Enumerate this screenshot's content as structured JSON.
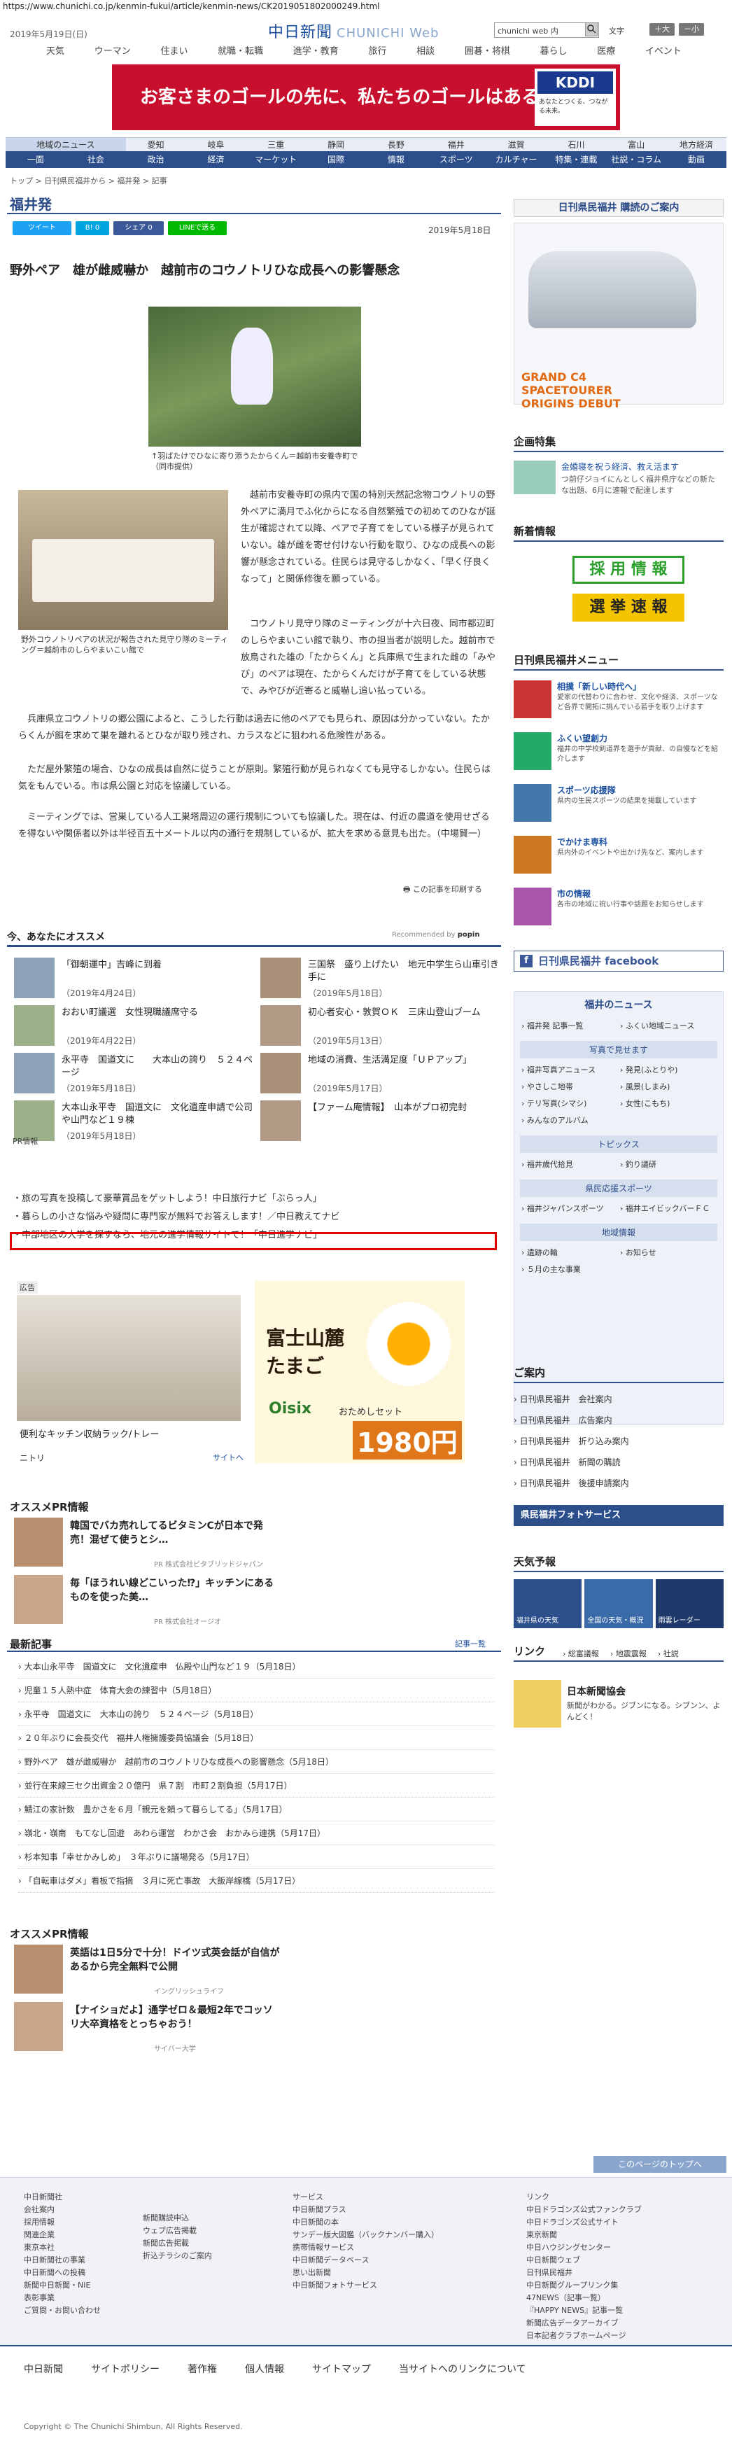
{
  "browser_url": "https://www.chunichi.co.jp/kenmin-fukui/article/kenmin-news/CK2019051802000249.html",
  "header": {
    "date": "2019年5月19日(日)",
    "logo": "中日新聞",
    "logo_sub": "CHUNICHI Web",
    "search_placeholder": "chunichi web 内",
    "font_label": "文字",
    "font_large": "＋大",
    "font_small": "－小",
    "global_nav": [
      "天気",
      "ウーマン",
      "住まい",
      "就職・転職",
      "進学・教育",
      "旅行",
      "相談",
      "囲碁・将棋",
      "暮らし",
      "医療",
      "イベント"
    ]
  },
  "banner": {
    "text": "お客さまのゴールの先に、私たちのゴールはある。",
    "brand": "KDDI",
    "sub": "あなたとつくる、つながる未来。"
  },
  "prefecture_nav": [
    "地域のニュース",
    "愛知",
    "岐阜",
    "三重",
    "静岡",
    "長野",
    "福井",
    "滋賀",
    "石川",
    "富山",
    "地方経済"
  ],
  "category_nav": [
    "一面",
    "社会",
    "政治",
    "経済",
    "マーケット",
    "国際",
    "情報",
    "スポーツ",
    "カルチャー",
    "特集・連載",
    "社説・コラム",
    "動画"
  ],
  "breadcrumb": "トップ > 日刊県民福井から > 福井発 > 記事",
  "section_title": "福井発",
  "share": {
    "tweet": "ツイート",
    "hatena": "B! 0",
    "facebook": "シェア 0",
    "line": "LINEで送る"
  },
  "article": {
    "date": "2019年5月18日",
    "title": "野外ペア　雄が雌威嚇か　越前市のコウノトリひな成長への影響懸念",
    "photo1_caption": "↑羽ばたけでひなに寄り添うたからくん＝越前市安養寺町で（同市提供）",
    "photo2_caption": "野外コウノトリペアの状況が報告された見守り隊のミーティング＝越前市のしらやまいこい館で",
    "p1": "越前市安養寺町の県内で国の特別天然記念物コウノトリの野外ペアに満月でふ化からになる自然繁殖での初めてのひなが誕生が確認されて以降、ペアで子育てをしている様子が見られていない。雄が雌を寄せ付けない行動を取り、ひなの成長への影響が懸念されている。住民らは見守るしかなく、「早く仔良くなって」と関係修復を願っている。",
    "p2": "コウノトリ見守り隊のミーティングが十六日夜、同市都辺町のしらやまいこい館で執り、市の担当者が説明した。越前市で放鳥された雄の「たからくん」と兵庫県で生まれた雌の「みやび」のペアは現在、たからくんだけが子育てをしている状態で、みやびが近寄ると威嚇し追い払っている。",
    "p3": "兵庫県立コウノトリの郷公園によると、こうした行動は過去に他のペアでも見られ、原因は分かっていない。たからくんが餌を求めて巣を離れるとひなが取り残され、カラスなどに狙われる危険性がある。",
    "p4": "ただ屋外繁殖の場合、ひなの成長は自然に従うことが原則。繁殖行動が見られなくても見守るしかない。住民らは気をもんでいる。市は県公園と対応を協議している。",
    "p5": "ミーティングでは、営巣している人工巣塔周辺の運行規制についても協議した。現在は、付近の農道を使用せざるを得ないや関係者以外は半径百五十メートル以内の通行を規制しているが、拡大を求める意見も出た。（中場賢一）",
    "print": "この記事を印刷する"
  },
  "recommend": {
    "title": "今、あなたにオススメ",
    "credit": "Recommended by",
    "items": [
      {
        "title": "「御朝運中」吉峰に到着",
        "date": "（2019年4月24日）"
      },
      {
        "title": "三国祭　盛り上げたい　地元中学生ら山車引き手に",
        "date": "（2019年5月18日）"
      },
      {
        "title": "おおい町議選　女性現職議席守る",
        "date": "（2019年4月22日）"
      },
      {
        "title": "初心者安心・敦賀ＯＫ　三床山登山ブーム",
        "date": "（2019年5月13日）"
      },
      {
        "title": "永平寺　国道文に　　大本山の誇り　５２４ページ",
        "date": "（2019年5月18日）"
      },
      {
        "title": "地域の消費、生活満足度「ＵＰアップ」",
        "date": "（2019年5月17日）"
      },
      {
        "title": "大本山永平寺　国道文に　文化遺産申請で公司や山門など１９棟",
        "date": "（2019年5月18日）"
      },
      {
        "title": "【ファーム庵情報】　山本がプロ初完封",
        "date": ""
      }
    ]
  },
  "pr": {
    "label": "PR情報",
    "items": [
      "旅の写真を投稿して豪華賞品をゲットしよう！中日旅行ナビ「ぶらっ人」",
      "暮らしの小さな悩みや疑問に専門家が無料でお答えします！／中日教えてナビ",
      "中部地区の大学を探すなら、地元の進学情報サイトで！「中日進学ナビ」"
    ]
  },
  "ad2": {
    "label": "広告",
    "left_caption": "便利なキッチン収納ラック/トレー",
    "left_brand": "ニトリ",
    "left_link": "サイトへ",
    "right_title": "富士山麓たまご",
    "right_brand": "Oisix",
    "right_sub": "おためしセット",
    "right_price": "1980円"
  },
  "osusume_pr": {
    "title": "オススメPR情報",
    "items": [
      {
        "title": "韓国でバカ売れしてるビタミンCが日本で発売！混ぜて使うとシ…",
        "sponsor": "PR 株式会社ビタブリッドジャパン"
      },
      {
        "title": "毎「ほうれい線どこいった⁉」キッチンにあるものを使った美…",
        "sponsor": "PR 株式会社オージオ"
      }
    ]
  },
  "latest": {
    "title": "最新記事",
    "link": "記事一覧",
    "items": [
      "大本山永平寺　国道文に　文化遺産申　仏殿や山門など１９（5月18日）",
      "児童１５人熱中症　体育大会の練習中（5月18日）",
      "永平寺　国道文に　大本山の誇り　５２４ページ（5月18日）",
      "２０年ぶりに会長交代　福井人権擁護委員協議会（5月18日）",
      "野外ペア　雄が雌威嚇か　越前市のコウノトリひな成長への影響懸念（5月18日）",
      "並行在来線三セク出資金２０億円　県７割　市町２割負担（5月17日）",
      "鯖江の家計数　豊かさを６月「親元を頼って暮らしてる」（5月17日）",
      "嶺北・嶺南　もてなし回遊　あわら運営　わかさ会　おかみら連携（5月17日）",
      "杉本知事「幸せかみしめ」　３年ぶりに議場発る（5月17日）",
      "「自転車はダメ」看板で指摘　３月に死亡事故　大飯岸線橋（5月17日）"
    ]
  },
  "osusume_pr2": {
    "title": "オススメPR情報",
    "items": [
      {
        "title": "英語は1日5分で十分！ドイツ式英会話が自信があるから完全無料で公開",
        "sponsor": "イングリッシュライフ"
      },
      {
        "title": "【ナイショだよ】通学ゼロ＆最短2年でコッソリ大卒資格をとっちゃおう！",
        "sponsor": "サイバー大学"
      }
    ]
  },
  "sidebar": {
    "kenmin_title": "日刊県民福井 購読のご案内",
    "car_ad": "GRAND C4 SPACETOURER ORIGINS DEBUT",
    "kikaku_title": "企画特集",
    "kikaku_item": "金婚寝を祝う経済、救え活ます",
    "kikaku_desc": "つ前仔ジョイにんとしく福井県庁などの新たな出題、6月に速報で配達します",
    "shinsotsu_title": "新着情報",
    "saiyo": "採 用 情 報",
    "senkyo": "選 挙 速 報",
    "menu_title": "日刊県民福井メニュー",
    "menu_items": [
      {
        "title": "相撲「新しい時代へ」",
        "desc": "愛家の代替わりに合わせ、文化や経済、スポーツなど各界で開拓に挑んでいる若手を取り上げます"
      },
      {
        "title": "ふくい望創力",
        "desc": "福井の中学校剣道界を選手が貢献、の自慢などを紹介します"
      },
      {
        "title": "スポーツ応援隊",
        "desc": "県内の生民スポーツの結果を掲載しています"
      },
      {
        "title": "でかけま専科",
        "desc": "県内外のイベントや出かけ先など、案内します"
      },
      {
        "title": "市の情報",
        "desc": "各市の地域に祝い行事や話題をお知らせします"
      }
    ],
    "facebook": "日刊県民福井 facebook",
    "fukui_news": "福井のニュース",
    "fukui_links": [
      "福井発 記事一覧",
      "ふくい地域ニュース"
    ],
    "photo_title": "写真で見せます",
    "photo_links": [
      "福井写真アニュース",
      "発見(ふとりや)",
      "やさしこ地帯",
      "風景(しまみ)",
      "テリ写真(シマシ)",
      "女性(こもち)",
      "みんなのアルバム"
    ],
    "topics_title": "トピックス",
    "topics_links": [
      "福井歳代拾見",
      "釣り議研"
    ],
    "sports_title": "県民応援スポーツ",
    "sports_links": [
      "福井ジャパンスポーツ",
      "福井エイビックバーＦＣ"
    ],
    "local_title": "地域情報",
    "local_links": [
      "遺跡の輪",
      "お知らせ",
      "５月の主な事業"
    ],
    "annai_title": "ご案内",
    "annai_links": [
      "日刊県民福井　会社案内",
      "日刊県民福井　広告案内",
      "日刊県民福井　折り込み案内",
      "日刊県民福井　新聞の購読",
      "日刊県民福井　後援申請案内"
    ],
    "photo_service": "県民福井フォトサービス",
    "weather_title": "天気予報",
    "weather_tiles": [
      "福井県の天気",
      "全国の天気・概況",
      "雨雲レーダー"
    ],
    "link_title": "リンク",
    "link_items": [
      "総富議報",
      "地震震報",
      "社説"
    ],
    "jinzai_title": "日本新聞協会",
    "jinzai_desc": "新聞がわかる。ジブンになる。シブンン、よんどく！"
  },
  "page_top": "このページのトップへ",
  "footer": {
    "col1": [
      "中日新聞社",
      "会社案内",
      "採用情報",
      "関連企業",
      "東京本社",
      "中日新聞社の事業",
      "中日新聞への投稿",
      "新聞中日新聞・NIE",
      "表彰事業",
      "ご質問・お問い合わせ"
    ],
    "col2": [
      "新聞購読申込",
      "ウェブ広告掲載",
      "新聞広告掲載",
      "折込チラシのご案内"
    ],
    "col3": [
      "サービス",
      "中日新聞プラス",
      "中日新聞の本",
      "サンデー版大図鑑（バックナンバー購入）",
      "携帯情報サービス",
      "中日新聞データベース",
      "思い出新聞",
      "中日新聞フォトサービス"
    ],
    "col4": [
      "リンク",
      "中日ドラゴンズ公式ファンクラブ",
      "中日ドラゴンズ公式サイト",
      "東京新聞",
      "中日ハウジングセンター",
      "中日新聞ウェブ",
      "日刊県民福井",
      "中日新聞グループリンク集",
      "47NEWS（記事一覧）",
      "『HAPPY NEWS』記事一覧",
      "新聞広告データアーカイブ",
      "日本記者クラブホームページ"
    ],
    "nav": [
      "中日新聞",
      "サイトポリシー",
      "著作権",
      "個人情報",
      "サイトマップ",
      "当サイトへのリンクについて"
    ],
    "copyright": "Copyright © The Chunichi Shimbun, All Rights Reserved."
  },
  "colors": {
    "accent": "#2c4f8c",
    "red": "#e00000",
    "banner": "#c8102e"
  }
}
